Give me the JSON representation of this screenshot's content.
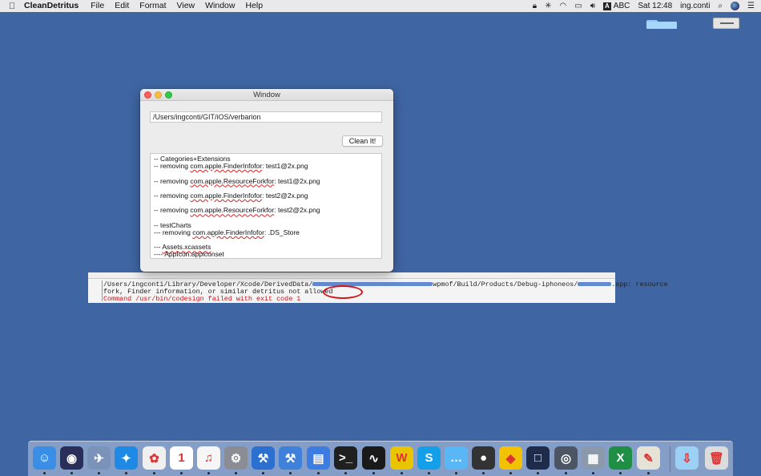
{
  "menubar": {
    "apple_icon": "apple-logo",
    "app_name": "CleanDetritus",
    "menus": [
      "File",
      "Edit",
      "Format",
      "View",
      "Window",
      "Help"
    ],
    "input_source_badge": "A",
    "input_source": "ABC",
    "clock": "Sat 12:48",
    "user": "ing.conti"
  },
  "window": {
    "title": "Window",
    "path_value": "/Users/ingconti/GIT/iOS/verbarion",
    "clean_button_label": "Clean It!",
    "log_lines": [
      {
        "pre": "-- Categories+Extensions",
        "sq": "",
        "post": ""
      },
      {
        "pre": "-- removing ",
        "sq": "com.apple.FinderInfofor",
        "post": ": test1@2x.png"
      },
      {
        "pre": "",
        "sq": "",
        "post": ""
      },
      {
        "pre": "-- removing ",
        "sq": "com.apple.ResourceForkfor",
        "post": ": test1@2x.png"
      },
      {
        "pre": "",
        "sq": "",
        "post": ""
      },
      {
        "pre": "-- removing ",
        "sq": "com.apple.FinderInfofor",
        "post": ": test2@2x.png"
      },
      {
        "pre": "",
        "sq": "",
        "post": ""
      },
      {
        "pre": "-- removing ",
        "sq": "com.apple.ResourceForkfor",
        "post": ": test2@2x.png"
      },
      {
        "pre": "",
        "sq": "",
        "post": ""
      },
      {
        "pre": "-- testCharts",
        "sq": "",
        "post": ""
      },
      {
        "pre": "--- removing ",
        "sq": "com.apple.FinderInfofor",
        "post": ": .DS_Store"
      },
      {
        "pre": "",
        "sq": "",
        "post": ""
      },
      {
        "pre": "--- ",
        "sq": "Assets.xcassets",
        "post": ""
      },
      {
        "pre": "---- ",
        "sq": "AppIcon.appiconset",
        "post": ""
      }
    ]
  },
  "terminal_excerpt": {
    "line1_a": "/Users/ingconti/Library/Developer/Xcode/DerivedData/",
    "line1_b": "wpmof/Build/Products/Debug-iphoneos/",
    "line1_c": ".app: resource",
    "line2": "  fork, Finder information, or similar detritus not allowed",
    "line3": "Command /usr/bin/codesign failed with exit code 1"
  },
  "dock_apps": [
    {
      "name": "finder",
      "color": "#3a8ee6",
      "glyph": "☺"
    },
    {
      "name": "siri",
      "color": "#2a2f5a",
      "glyph": "◉"
    },
    {
      "name": "launchpad",
      "color": "#7b93b8",
      "glyph": "✈"
    },
    {
      "name": "safari",
      "color": "#1e8ae6",
      "glyph": "✦"
    },
    {
      "name": "photos",
      "color": "#f0f0f0",
      "glyph": "✿"
    },
    {
      "name": "calendar",
      "color": "#ffffff",
      "glyph": "1"
    },
    {
      "name": "itunes",
      "color": "#f6f6f6",
      "glyph": "♫"
    },
    {
      "name": "system-preferences",
      "color": "#8a8d93",
      "glyph": "⚙"
    },
    {
      "name": "xcode",
      "color": "#2b6fd1",
      "glyph": "⚒"
    },
    {
      "name": "xcode-beta",
      "color": "#3f80da",
      "glyph": "⚒"
    },
    {
      "name": "keynote",
      "color": "#3d7ce0",
      "glyph": "▤"
    },
    {
      "name": "terminal",
      "color": "#202020",
      "glyph": ">_"
    },
    {
      "name": "activity-monitor",
      "color": "#1a1a1a",
      "glyph": "∿"
    },
    {
      "name": "word-app",
      "color": "#e8c500",
      "glyph": "W"
    },
    {
      "name": "skype",
      "color": "#13a0e8",
      "glyph": "S"
    },
    {
      "name": "messages",
      "color": "#5ab7f5",
      "glyph": "…"
    },
    {
      "name": "camera-app",
      "color": "#333333",
      "glyph": "●"
    },
    {
      "name": "cyberduck",
      "color": "#f2c200",
      "glyph": "◆"
    },
    {
      "name": "preview",
      "color": "#1e2b4a",
      "glyph": "□"
    },
    {
      "name": "network-utility",
      "color": "#4b5563",
      "glyph": "◎"
    },
    {
      "name": "image-capture",
      "color": "#8b99ac",
      "glyph": "▦"
    },
    {
      "name": "excel",
      "color": "#1f8f45",
      "glyph": "X"
    },
    {
      "name": "clean-detritus",
      "color": "#e7e2d6",
      "glyph": "✎"
    },
    {
      "name": "downloads-folder",
      "color": "#9cd0f5",
      "glyph": "⇩"
    },
    {
      "name": "trash",
      "color": "#dcdcdc",
      "glyph": "🗑"
    }
  ]
}
